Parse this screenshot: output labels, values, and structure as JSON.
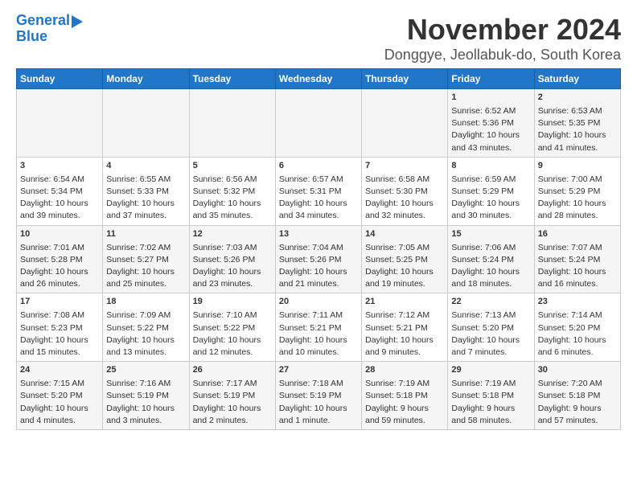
{
  "logo": {
    "line1": "General",
    "line2": "Blue"
  },
  "title": "November 2024",
  "location": "Donggye, Jeollabuk-do, South Korea",
  "weekdays": [
    "Sunday",
    "Monday",
    "Tuesday",
    "Wednesday",
    "Thursday",
    "Friday",
    "Saturday"
  ],
  "weeks": [
    [
      {
        "day": "",
        "info": ""
      },
      {
        "day": "",
        "info": ""
      },
      {
        "day": "",
        "info": ""
      },
      {
        "day": "",
        "info": ""
      },
      {
        "day": "",
        "info": ""
      },
      {
        "day": "1",
        "info": "Sunrise: 6:52 AM\nSunset: 5:36 PM\nDaylight: 10 hours and 43 minutes."
      },
      {
        "day": "2",
        "info": "Sunrise: 6:53 AM\nSunset: 5:35 PM\nDaylight: 10 hours and 41 minutes."
      }
    ],
    [
      {
        "day": "3",
        "info": "Sunrise: 6:54 AM\nSunset: 5:34 PM\nDaylight: 10 hours and 39 minutes."
      },
      {
        "day": "4",
        "info": "Sunrise: 6:55 AM\nSunset: 5:33 PM\nDaylight: 10 hours and 37 minutes."
      },
      {
        "day": "5",
        "info": "Sunrise: 6:56 AM\nSunset: 5:32 PM\nDaylight: 10 hours and 35 minutes."
      },
      {
        "day": "6",
        "info": "Sunrise: 6:57 AM\nSunset: 5:31 PM\nDaylight: 10 hours and 34 minutes."
      },
      {
        "day": "7",
        "info": "Sunrise: 6:58 AM\nSunset: 5:30 PM\nDaylight: 10 hours and 32 minutes."
      },
      {
        "day": "8",
        "info": "Sunrise: 6:59 AM\nSunset: 5:29 PM\nDaylight: 10 hours and 30 minutes."
      },
      {
        "day": "9",
        "info": "Sunrise: 7:00 AM\nSunset: 5:29 PM\nDaylight: 10 hours and 28 minutes."
      }
    ],
    [
      {
        "day": "10",
        "info": "Sunrise: 7:01 AM\nSunset: 5:28 PM\nDaylight: 10 hours and 26 minutes."
      },
      {
        "day": "11",
        "info": "Sunrise: 7:02 AM\nSunset: 5:27 PM\nDaylight: 10 hours and 25 minutes."
      },
      {
        "day": "12",
        "info": "Sunrise: 7:03 AM\nSunset: 5:26 PM\nDaylight: 10 hours and 23 minutes."
      },
      {
        "day": "13",
        "info": "Sunrise: 7:04 AM\nSunset: 5:26 PM\nDaylight: 10 hours and 21 minutes."
      },
      {
        "day": "14",
        "info": "Sunrise: 7:05 AM\nSunset: 5:25 PM\nDaylight: 10 hours and 19 minutes."
      },
      {
        "day": "15",
        "info": "Sunrise: 7:06 AM\nSunset: 5:24 PM\nDaylight: 10 hours and 18 minutes."
      },
      {
        "day": "16",
        "info": "Sunrise: 7:07 AM\nSunset: 5:24 PM\nDaylight: 10 hours and 16 minutes."
      }
    ],
    [
      {
        "day": "17",
        "info": "Sunrise: 7:08 AM\nSunset: 5:23 PM\nDaylight: 10 hours and 15 minutes."
      },
      {
        "day": "18",
        "info": "Sunrise: 7:09 AM\nSunset: 5:22 PM\nDaylight: 10 hours and 13 minutes."
      },
      {
        "day": "19",
        "info": "Sunrise: 7:10 AM\nSunset: 5:22 PM\nDaylight: 10 hours and 12 minutes."
      },
      {
        "day": "20",
        "info": "Sunrise: 7:11 AM\nSunset: 5:21 PM\nDaylight: 10 hours and 10 minutes."
      },
      {
        "day": "21",
        "info": "Sunrise: 7:12 AM\nSunset: 5:21 PM\nDaylight: 10 hours and 9 minutes."
      },
      {
        "day": "22",
        "info": "Sunrise: 7:13 AM\nSunset: 5:20 PM\nDaylight: 10 hours and 7 minutes."
      },
      {
        "day": "23",
        "info": "Sunrise: 7:14 AM\nSunset: 5:20 PM\nDaylight: 10 hours and 6 minutes."
      }
    ],
    [
      {
        "day": "24",
        "info": "Sunrise: 7:15 AM\nSunset: 5:20 PM\nDaylight: 10 hours and 4 minutes."
      },
      {
        "day": "25",
        "info": "Sunrise: 7:16 AM\nSunset: 5:19 PM\nDaylight: 10 hours and 3 minutes."
      },
      {
        "day": "26",
        "info": "Sunrise: 7:17 AM\nSunset: 5:19 PM\nDaylight: 10 hours and 2 minutes."
      },
      {
        "day": "27",
        "info": "Sunrise: 7:18 AM\nSunset: 5:19 PM\nDaylight: 10 hours and 1 minute."
      },
      {
        "day": "28",
        "info": "Sunrise: 7:19 AM\nSunset: 5:18 PM\nDaylight: 9 hours and 59 minutes."
      },
      {
        "day": "29",
        "info": "Sunrise: 7:19 AM\nSunset: 5:18 PM\nDaylight: 9 hours and 58 minutes."
      },
      {
        "day": "30",
        "info": "Sunrise: 7:20 AM\nSunset: 5:18 PM\nDaylight: 9 hours and 57 minutes."
      }
    ]
  ]
}
